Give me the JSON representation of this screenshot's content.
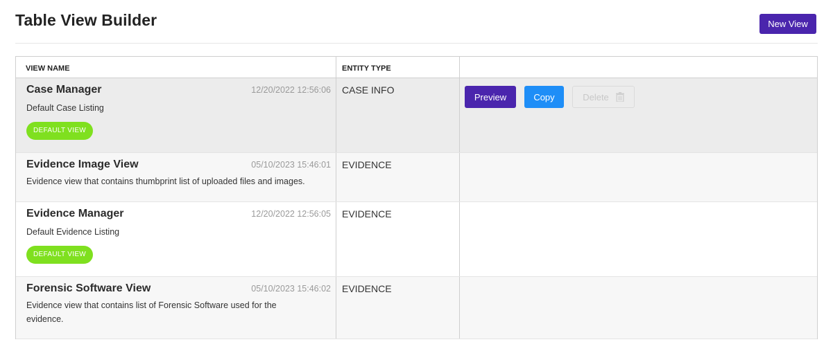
{
  "header": {
    "title": "Table View Builder",
    "new_view_label": "New View"
  },
  "table": {
    "columns": [
      "VIEW NAME",
      "ENTITY TYPE",
      ""
    ],
    "rows": [
      {
        "name": "Case Manager",
        "timestamp": "12/20/2022 12:56:06",
        "description": "Default Case Listing",
        "badge": "DEFAULT VIEW",
        "entity_type": "CASE INFO"
      },
      {
        "name": "Evidence Image View",
        "timestamp": "05/10/2023 15:46:01",
        "description": "Evidence view that contains thumbprint list of uploaded files and images.",
        "badge": "",
        "entity_type": "EVIDENCE"
      },
      {
        "name": "Evidence Manager",
        "timestamp": "12/20/2022 12:56:05",
        "description": "Default Evidence Listing",
        "badge": "DEFAULT VIEW",
        "entity_type": "EVIDENCE"
      },
      {
        "name": "Forensic Software View",
        "timestamp": "05/10/2023 15:46:02",
        "description": "Evidence view that contains list of Forensic Software used for the evidence.",
        "badge": "",
        "entity_type": "EVIDENCE"
      }
    ]
  },
  "actions": {
    "preview_label": "Preview",
    "copy_label": "Copy",
    "delete_label": "Delete",
    "delete_icon": "trash-icon"
  },
  "colors": {
    "primary": "#4a25ad",
    "copy": "#1e8ef7",
    "badge": "#7fe01f"
  }
}
